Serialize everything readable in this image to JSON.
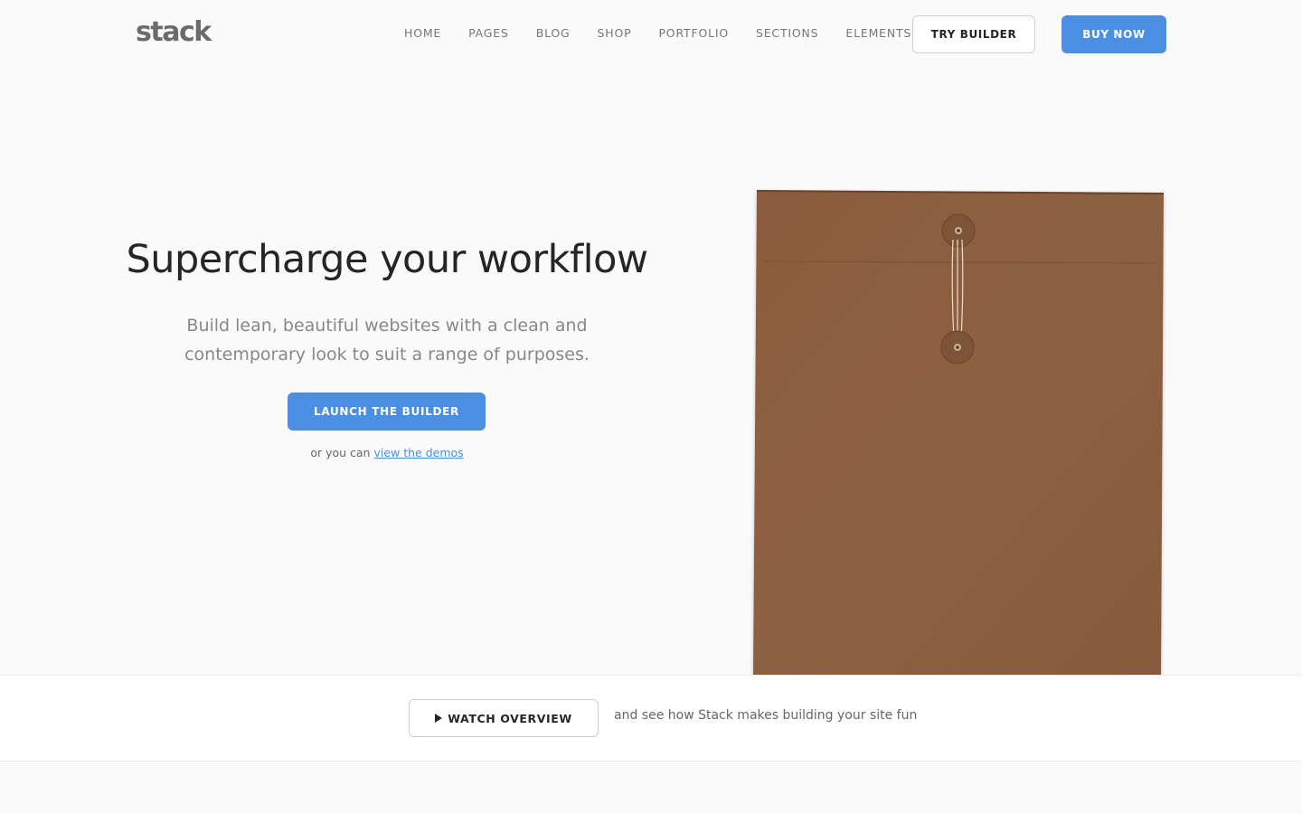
{
  "header": {
    "logo": "stack",
    "nav": [
      "HOME",
      "PAGES",
      "BLOG",
      "SHOP",
      "PORTFOLIO",
      "SECTIONS",
      "ELEMENTS"
    ],
    "try_builder_label": "TRY BUILDER",
    "buy_now_label": "BUY NOW"
  },
  "hero": {
    "title": "Supercharge your workflow",
    "subtitle": "Build lean, beautiful websites with a clean and contemporary look to suit a range of purposes.",
    "cta_label": "LAUNCH THE BUILDER",
    "demo_prefix": "or you can",
    "demo_link": "view the demos",
    "image_icon": "envelope-image"
  },
  "strip": {
    "watch_label": "WATCH OVERVIEW",
    "watch_icon": "play-icon",
    "caption": "and see how Stack makes building your site fun"
  },
  "colors": {
    "accent": "#4a8fe2",
    "background": "#fafafa",
    "envelope": "#8b5e3f"
  }
}
